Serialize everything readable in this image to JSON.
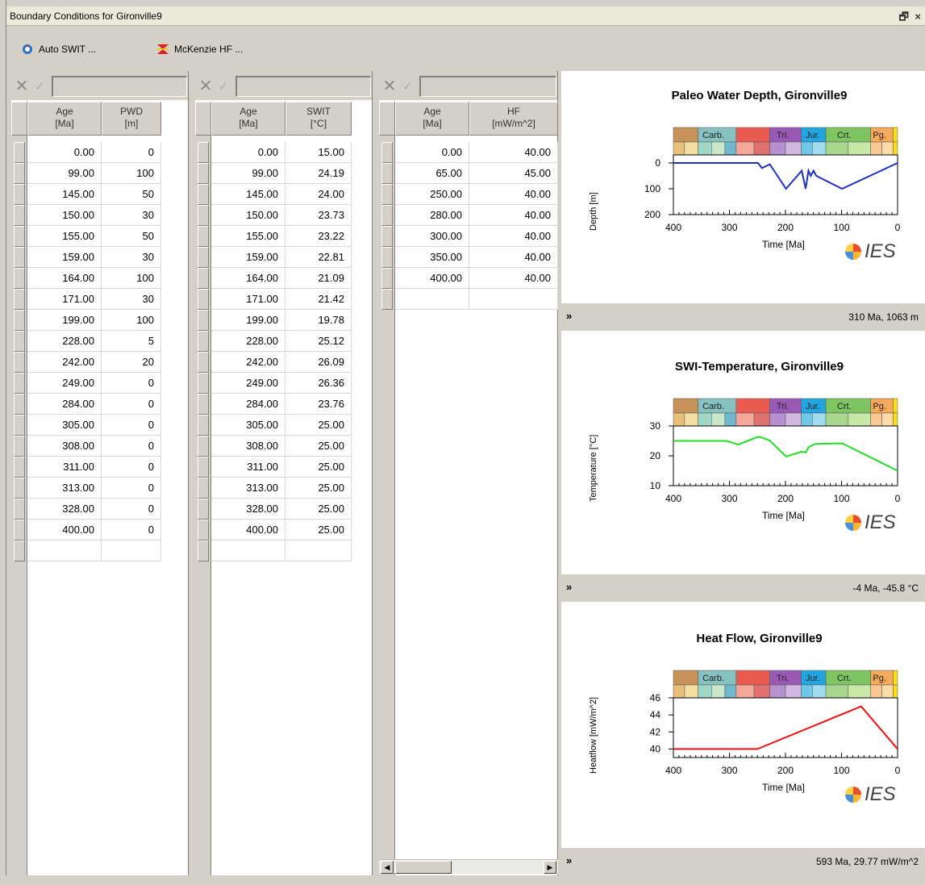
{
  "window": {
    "title": "Boundary Conditions for Gironville9",
    "restore_icon": "restore-icon",
    "close_label": "×"
  },
  "toolbar": {
    "auto_swit_label": "Auto SWIT ...",
    "mckenzie_label": "McKenzie HF ..."
  },
  "grids": [
    {
      "columns": [
        {
          "line1": "Age",
          "line2": "[Ma]"
        },
        {
          "line1": "PWD",
          "line2": "[m]"
        }
      ],
      "rows": [
        [
          "0.00",
          "0"
        ],
        [
          "99.00",
          "100"
        ],
        [
          "145.00",
          "50"
        ],
        [
          "150.00",
          "30"
        ],
        [
          "155.00",
          "50"
        ],
        [
          "159.00",
          "30"
        ],
        [
          "164.00",
          "100"
        ],
        [
          "171.00",
          "30"
        ],
        [
          "199.00",
          "100"
        ],
        [
          "228.00",
          "5"
        ],
        [
          "242.00",
          "20"
        ],
        [
          "249.00",
          "0"
        ],
        [
          "284.00",
          "0"
        ],
        [
          "305.00",
          "0"
        ],
        [
          "308.00",
          "0"
        ],
        [
          "311.00",
          "0"
        ],
        [
          "313.00",
          "0"
        ],
        [
          "328.00",
          "0"
        ],
        [
          "400.00",
          "0"
        ]
      ]
    },
    {
      "columns": [
        {
          "line1": "Age",
          "line2": "[Ma]"
        },
        {
          "line1": "SWIT",
          "line2": "[°C]"
        }
      ],
      "rows": [
        [
          "0.00",
          "15.00"
        ],
        [
          "99.00",
          "24.19"
        ],
        [
          "145.00",
          "24.00"
        ],
        [
          "150.00",
          "23.73"
        ],
        [
          "155.00",
          "23.22"
        ],
        [
          "159.00",
          "22.81"
        ],
        [
          "164.00",
          "21.09"
        ],
        [
          "171.00",
          "21.42"
        ],
        [
          "199.00",
          "19.78"
        ],
        [
          "228.00",
          "25.12"
        ],
        [
          "242.00",
          "26.09"
        ],
        [
          "249.00",
          "26.36"
        ],
        [
          "284.00",
          "23.76"
        ],
        [
          "305.00",
          "25.00"
        ],
        [
          "308.00",
          "25.00"
        ],
        [
          "311.00",
          "25.00"
        ],
        [
          "313.00",
          "25.00"
        ],
        [
          "328.00",
          "25.00"
        ],
        [
          "400.00",
          "25.00"
        ]
      ]
    },
    {
      "columns": [
        {
          "line1": "Age",
          "line2": "[Ma]"
        },
        {
          "line1": "HF",
          "line2": "[mW/m^2]"
        }
      ],
      "rows": [
        [
          "0.00",
          "40.00"
        ],
        [
          "65.00",
          "45.00"
        ],
        [
          "250.00",
          "40.00"
        ],
        [
          "280.00",
          "40.00"
        ],
        [
          "300.00",
          "40.00"
        ],
        [
          "350.00",
          "40.00"
        ],
        [
          "400.00",
          "40.00"
        ]
      ]
    }
  ],
  "strat_labels": [
    "Carb.",
    "Tri.",
    "Jur.",
    "Crt.",
    "Pg."
  ],
  "chart_data": [
    {
      "type": "line",
      "title": "Paleo Water Depth, Gironville9",
      "xlabel": "Time [Ma]",
      "ylabel": "Depth [m]",
      "xlim": [
        400,
        0
      ],
      "ylim": [
        0,
        200
      ],
      "inverted_y": true,
      "xticks": [
        400,
        300,
        200,
        100,
        0
      ],
      "yticks": [
        0,
        100,
        200
      ],
      "color": "#1f2fbf",
      "x": [
        400,
        328,
        313,
        311,
        308,
        305,
        284,
        249,
        242,
        228,
        199,
        171,
        164,
        159,
        155,
        150,
        145,
        99,
        0
      ],
      "y": [
        0,
        0,
        0,
        0,
        0,
        0,
        0,
        0,
        20,
        5,
        100,
        30,
        100,
        30,
        50,
        30,
        50,
        100,
        0
      ],
      "status": "310 Ma, 1063 m"
    },
    {
      "type": "line",
      "title": "SWI-Temperature, Gironville9",
      "xlabel": "Time [Ma]",
      "ylabel": "Temperature [°C]",
      "xlim": [
        400,
        0
      ],
      "ylim": [
        10,
        30
      ],
      "xticks": [
        400,
        300,
        200,
        100,
        0
      ],
      "yticks": [
        10,
        20,
        30
      ],
      "color": "#22dd22",
      "x": [
        400,
        328,
        313,
        311,
        308,
        305,
        284,
        249,
        242,
        228,
        199,
        171,
        164,
        159,
        155,
        150,
        145,
        99,
        0
      ],
      "y": [
        25.0,
        25.0,
        25.0,
        25.0,
        25.0,
        25.0,
        23.76,
        26.36,
        26.09,
        25.12,
        19.78,
        21.42,
        21.09,
        22.81,
        23.22,
        23.73,
        24.0,
        24.19,
        15.0
      ],
      "status": "-4 Ma, -45.8 °C"
    },
    {
      "type": "line",
      "title": "Heat Flow, Gironville9",
      "xlabel": "Time [Ma]",
      "ylabel": "Heatflow [mW/m^2]",
      "xlim": [
        400,
        0
      ],
      "ylim": [
        39,
        46
      ],
      "xticks": [
        400,
        300,
        200,
        100,
        0
      ],
      "yticks": [
        40,
        42,
        44,
        46
      ],
      "color": "#ee1111",
      "x": [
        400,
        350,
        300,
        280,
        250,
        65,
        0
      ],
      "y": [
        40,
        40,
        40,
        40,
        40,
        45,
        40
      ],
      "status": "593 Ma, 29.77 mW/m^2"
    }
  ],
  "logo_text": "IES",
  "chevron": "»"
}
